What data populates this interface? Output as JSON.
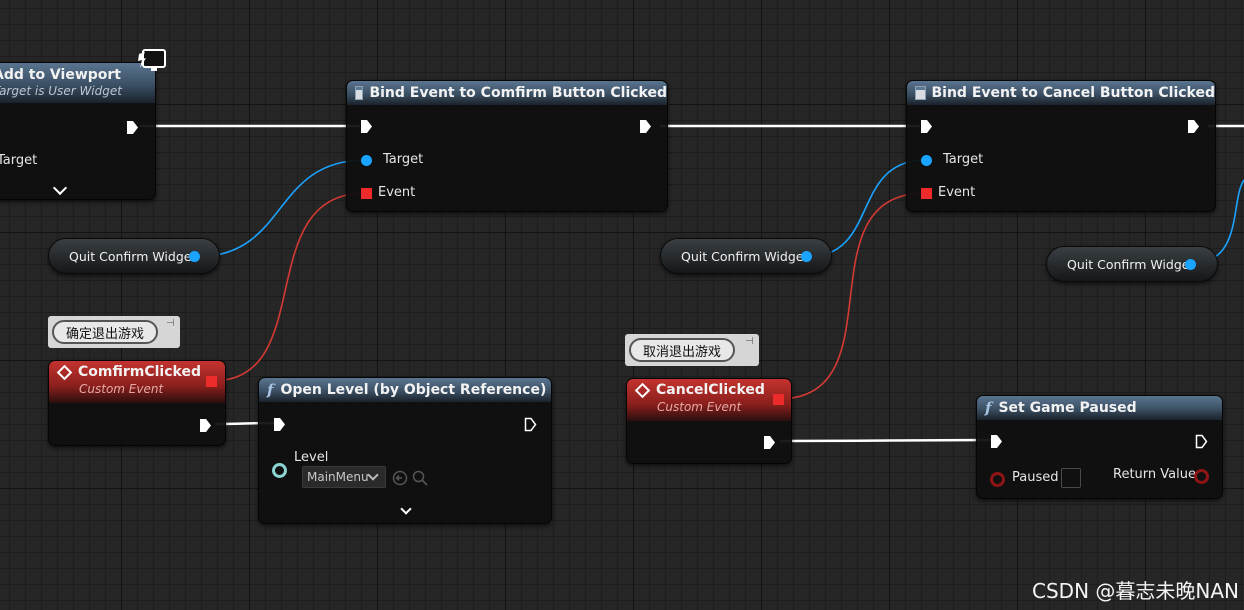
{
  "nodes": {
    "add_to_viewport": {
      "title": "Add to Viewport",
      "subtitle": "Target is User Widget",
      "pin_target": "Target"
    },
    "bind_confirm": {
      "title": "Bind Event to Comfirm Button Clicked",
      "pin_target": "Target",
      "pin_event": "Event"
    },
    "bind_cancel": {
      "title": "Bind Event to Cancel Button Clicked",
      "pin_target": "Target",
      "pin_event": "Event"
    },
    "confirm_event": {
      "title": "ComfirmClicked",
      "subtitle": "Custom Event",
      "comment": "确定退出游戏"
    },
    "cancel_event": {
      "title": "CancelClicked",
      "subtitle": "Custom Event",
      "comment": "取消退出游戏"
    },
    "open_level": {
      "title": "Open Level (by Object Reference)",
      "pin_level": "Level",
      "level_value": "MainMenu"
    },
    "set_game_paused": {
      "title": "Set Game Paused",
      "pin_paused": "Paused",
      "pin_return": "Return Value"
    }
  },
  "variables": [
    {
      "label": "Quit Confirm Widget"
    },
    {
      "label": "Quit Confirm Widget"
    },
    {
      "label": "Quit Confirm Widget"
    }
  ],
  "colors": {
    "exec_wire": "#ffffff",
    "object_wire": "#1aa3ff",
    "delegate_wire": "#d33a33",
    "function_header": "#3b4f63",
    "event_header": "#8a1f1c"
  },
  "icons": {
    "function": "f-function-icon",
    "event": "diamond-event-icon",
    "bind": "event-dispatcher-icon",
    "network": "monitor-lightning-icon"
  },
  "watermark": "CSDN @暮志未晚NAN"
}
